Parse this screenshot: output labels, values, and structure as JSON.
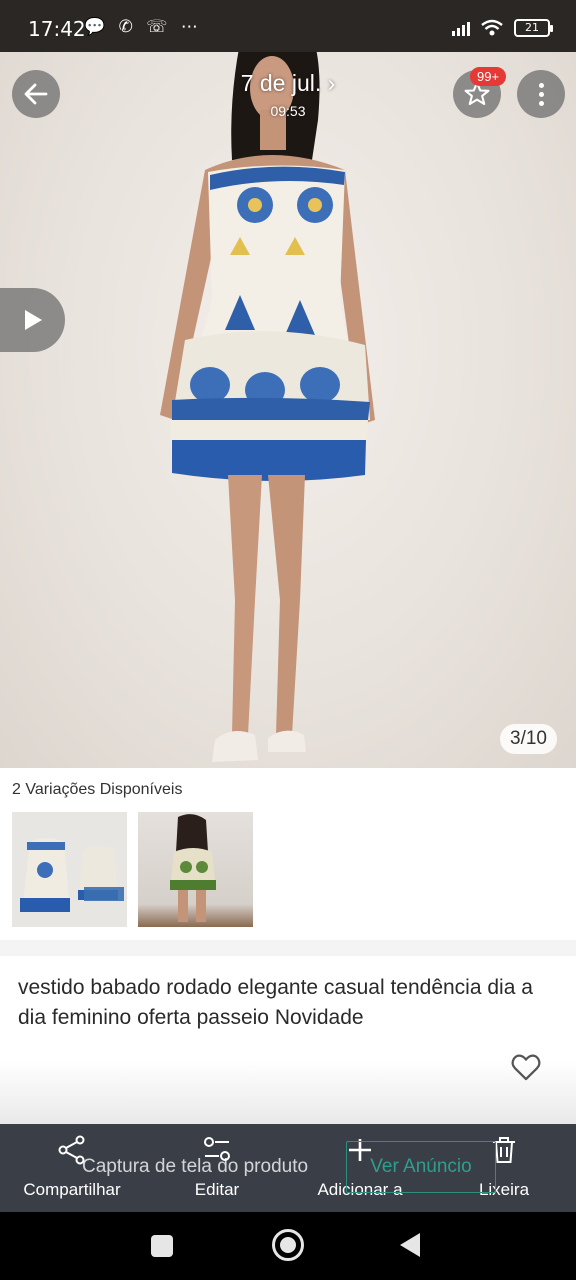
{
  "status_bar": {
    "time": "17:42",
    "left_icons": "💬 ✆ ☏ ⋯",
    "battery": "21"
  },
  "header": {
    "date": "7 de jul. ›",
    "time": "09:53",
    "badge": "99+",
    "icons": [
      "back-arrow-icon",
      "star-icon",
      "more-vertical-icon",
      "play-icon"
    ]
  },
  "gallery": {
    "counter": "3/10"
  },
  "variations": {
    "label": "2 Variações Disponíveis"
  },
  "product": {
    "description": "vestido babado rodado elegante casual tendência dia a dia feminino oferta  passeio Novidade"
  },
  "actions": {
    "items": [
      {
        "label": "Compartilhar",
        "icon": "share-icon"
      },
      {
        "label": "Editar",
        "icon": "edit-sliders-icon"
      },
      {
        "label": "Adicionar a",
        "icon": "plus-icon"
      },
      {
        "label": "Lixeira",
        "icon": "trash-icon"
      }
    ],
    "overlay_text": "Captura de tela do produto",
    "overlay_button": "Ver Anúncio"
  },
  "colors": {
    "action_bar": "#3a3e47",
    "badge": "#e53935",
    "overlay_accent": "#2f9e8e"
  }
}
